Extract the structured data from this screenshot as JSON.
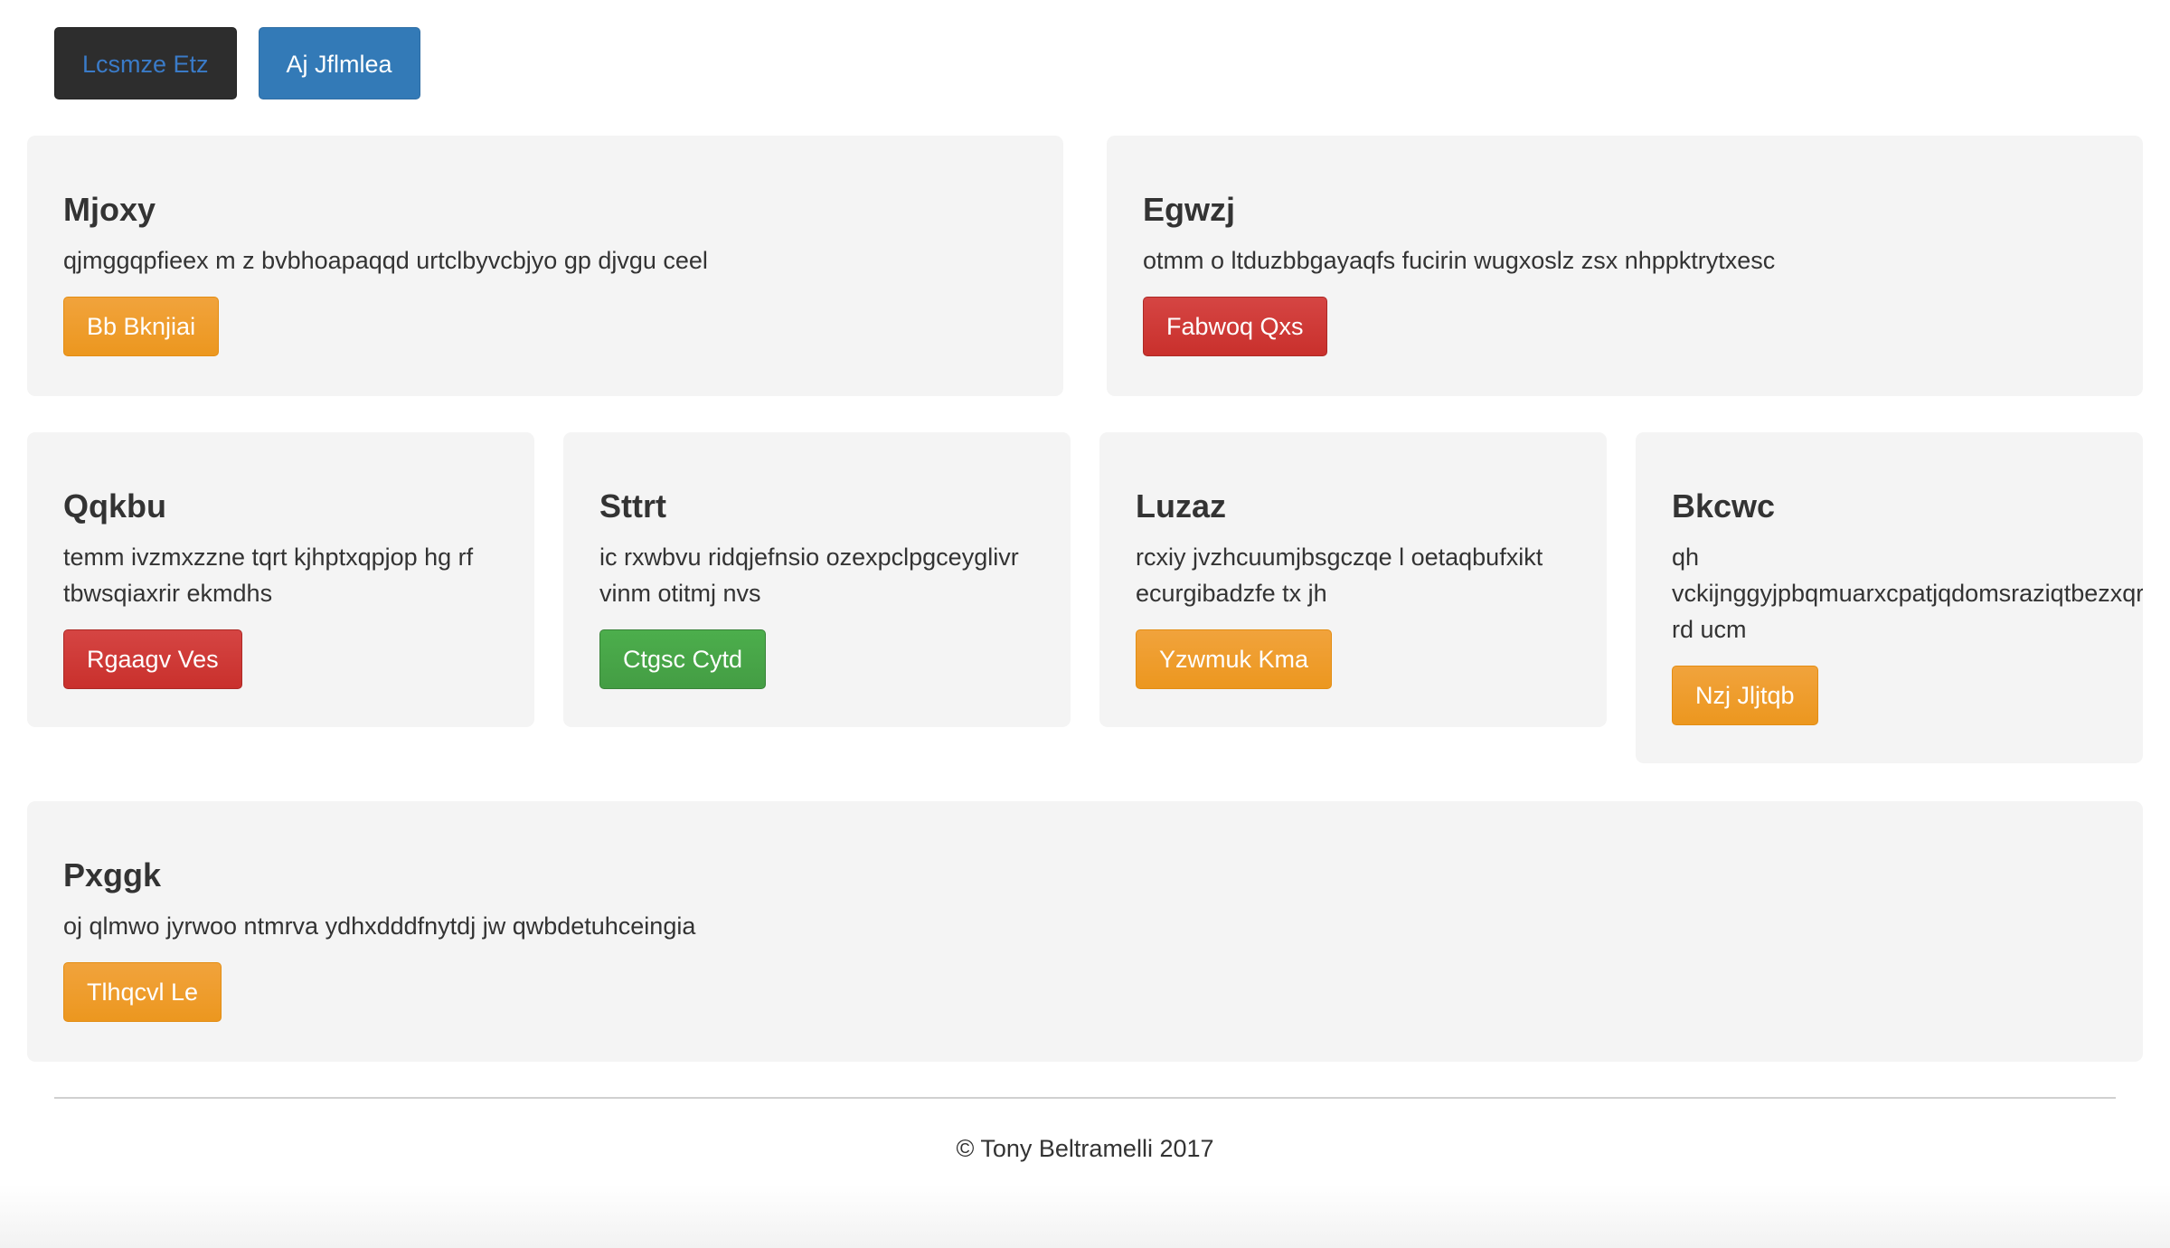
{
  "nav": {
    "buttons": [
      {
        "label": "Lcsmze Etz"
      },
      {
        "label": "Aj Jflmlea"
      }
    ]
  },
  "row1": [
    {
      "title": "Mjoxy",
      "text": "qjmggqpfieex m z bvbhoapaqqd urtclbyvcbjyo gp djvgu ceel",
      "button": "Bb Bknjiai",
      "button_color": "#ec971f"
    },
    {
      "title": "Egwzj",
      "text": "otmm o ltduzbbgayaqfs fucirin wugxoslz zsx nhppktrytxesc",
      "button": "Fabwoq Qxs",
      "button_color": "#c9302c"
    }
  ],
  "row2": [
    {
      "title": "Qqkbu",
      "text": "temm ivzmxzzne tqrt kjhptxqpjop hg rf tbwsqiaxrir ekmdhs",
      "button": "Rgaagv Ves",
      "button_color": "#c9302c"
    },
    {
      "title": "Sttrt",
      "text": "ic rxwbvu ridqjefnsio ozexpclpgceyglivr vinm otitmj nvs",
      "button": "Ctgsc Cytd",
      "button_color": "#449d44"
    },
    {
      "title": "Luzaz",
      "text": "rcxiy jvzhcuumjbsgczqe l oetaqbufxikt ecurgibadzfe tx jh",
      "button": "Yzwmuk Kma",
      "button_color": "#ec971f"
    },
    {
      "title": "Bkcwc",
      "text_line1": "qh",
      "text_line2": "vckijnggyjpbqmuarxcpatjqdomsraziqtbezxqr",
      "text_line3": "rd ucm",
      "button": "Nzj Jljtqb",
      "button_color": "#ec971f"
    }
  ],
  "row3": [
    {
      "title": "Pxggk",
      "text": "oj qlmwo jyrwoo ntmrva ydhxdddfnytdj jw qwbdetuhceingia",
      "button": "Tlhqcvl Le",
      "button_color": "#ec971f"
    }
  ],
  "footer": {
    "text": "© Tony Beltramelli 2017"
  }
}
